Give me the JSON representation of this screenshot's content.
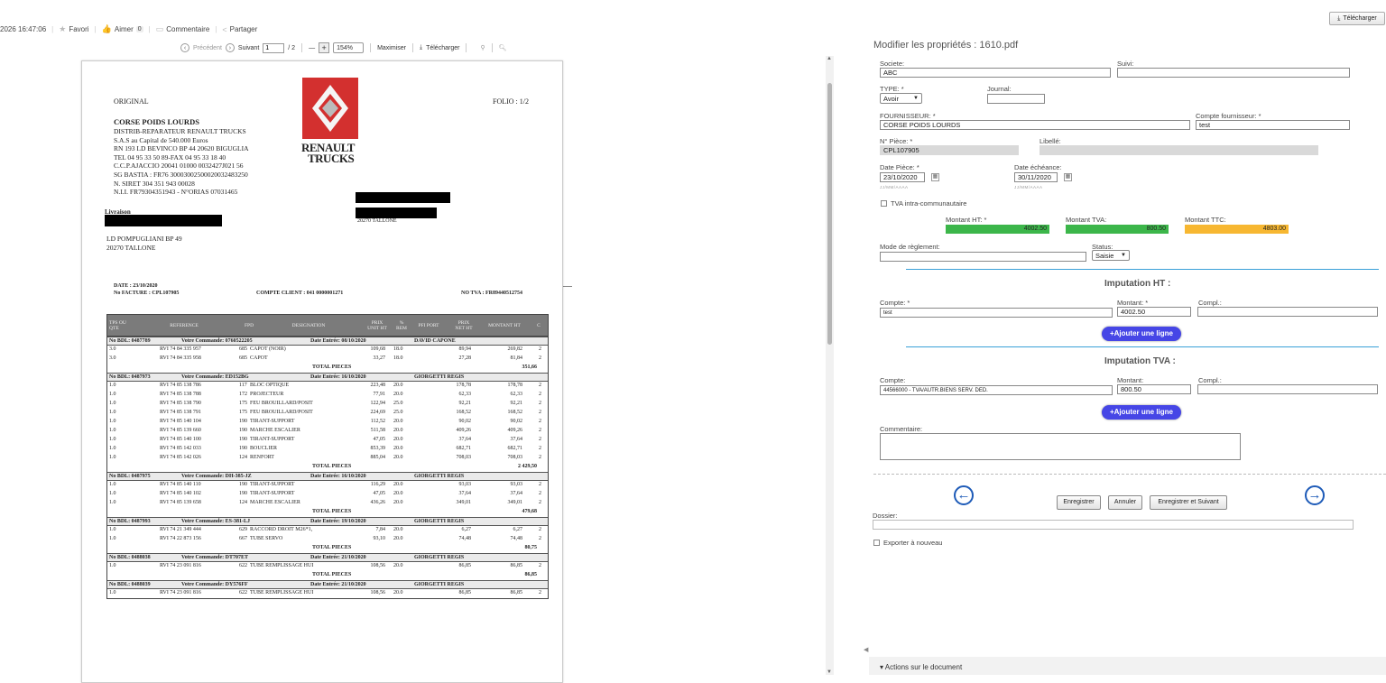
{
  "meta": {
    "datetime": "2026 16:47:06",
    "favori": "Favori",
    "aimer": "Aimer",
    "aimer_count": "0",
    "commentaire": "Commentaire",
    "partager": "Partager",
    "telecharger_top": "Télécharger"
  },
  "viewer": {
    "precedent": "Précédent",
    "suivant": "Suivant",
    "page_value": "1",
    "page_total": "/ 2",
    "minus": "—",
    "plus": "+",
    "zoom": "154%",
    "maximiser": "Maximiser",
    "telecharger": "Télécharger"
  },
  "invoice": {
    "original": "ORIGINAL",
    "folio": "FOLIO :  1/2",
    "company_name": "CORSE POIDS LOURDS",
    "company_lines": [
      "DISTRIB-REPARATEUR RENAULT TRUCKS",
      "S.A.S au Capital de 540.000 Euros",
      "RN 193 LD BEVINCO BP 44 20620 BIGUGLIA",
      "TEL 04 95 33 50 89-FAX 04 95 33 18 40",
      "C.C.P.AJACCIO 20041 01000 0032427J021 56",
      "SG BASTIA : FR76 30003002500020032483250",
      "N. SIRET 304 351 943 00028",
      "N.I.I. FR79304351943 - N°ORIAS 07031465"
    ],
    "logo_text_1": "RENAULT",
    "logo_text_2": "TRUCKS",
    "livraison": "Livraison",
    "delivery_lines": [
      "LD POMPUGLIANI BP 49",
      "20270 TALLONE"
    ],
    "client_city": "20270 TALLONE",
    "date_line": "DATE :  23/10/2020",
    "facture_line": "No  FACTURE : CPL107905",
    "compte_client": "COMPTE CLIENT : 041  0000001271",
    "no_tva": "NO TVA :  FR89440512754",
    "headers": [
      "TPS OU QTE",
      "REFERENCE",
      "FPD",
      "DESIGNATION",
      "PRIX UNIT HT",
      "% REM",
      "PFI PORT",
      "PRIX NET HT",
      "MONTANT HT",
      "C"
    ],
    "rows": [
      {
        "type": "grp",
        "bdl": "No  BDL: 0487789",
        "cmd": "Votre Commande: 0760522205",
        "date": "Date Entrée: 08/10/2020",
        "who": "DAVID CAPONE"
      },
      {
        "type": "line",
        "q": "3.0",
        "ref": "RVI 74 84 335 957",
        "fpd": "685",
        "des": "CAPOT (NOIR)",
        "pu": "109,68",
        "rem": "18.0",
        "net": "89,94",
        "mt": "269,82",
        "c": "2"
      },
      {
        "type": "line",
        "q": "3.0",
        "ref": "RVI 74 84 335 958",
        "fpd": "685",
        "des": "CAPOT",
        "pu": "33,27",
        "rem": "18.0",
        "net": "27,28",
        "mt": "81,84",
        "c": "2"
      },
      {
        "type": "tot",
        "label": "TOTAL PIECES",
        "mt": "351,66"
      },
      {
        "type": "grp",
        "bdl": "No  BDL: 0487973",
        "cmd": "Votre Commande: ED152BG",
        "date": "Date Entrée: 16/10/2020",
        "who": "GIORGETTI REGIS"
      },
      {
        "type": "line",
        "q": "1.0",
        "ref": "RVI 74 85 138 786",
        "fpd": "117",
        "des": "BLOC OPTIQUE",
        "pu": "223,48",
        "rem": "20.0",
        "net": "178,78",
        "mt": "178,78",
        "c": "2"
      },
      {
        "type": "line",
        "q": "1.0",
        "ref": "RVI 74 85 138 788",
        "fpd": "172",
        "des": "PROJECTEUR",
        "pu": "77,91",
        "rem": "20.0",
        "net": "62,33",
        "mt": "62,33",
        "c": "2"
      },
      {
        "type": "line",
        "q": "1.0",
        "ref": "RVI 74 85 138 790",
        "fpd": "175",
        "des": "FEU BROUILLARD/POSIT",
        "pu": "122,94",
        "rem": "25.0",
        "net": "92,21",
        "mt": "92,21",
        "c": "2"
      },
      {
        "type": "line",
        "q": "1.0",
        "ref": "RVI 74 85 138 791",
        "fpd": "175",
        "des": "FEU BROUILLARD/POSIT",
        "pu": "224,69",
        "rem": "25.0",
        "net": "168,52",
        "mt": "168,52",
        "c": "2"
      },
      {
        "type": "line",
        "q": "1.0",
        "ref": "RVI 74 85 140 104",
        "fpd": "190",
        "des": "TIRANT-SUPPORT",
        "pu": "112,52",
        "rem": "20.0",
        "net": "90,02",
        "mt": "90,02",
        "c": "2"
      },
      {
        "type": "line",
        "q": "1.0",
        "ref": "RVI 74 85 139 660",
        "fpd": "190",
        "des": "MARCHE ESCALIER",
        "pu": "511,58",
        "rem": "20.0",
        "net": "409,26",
        "mt": "409,26",
        "c": "2"
      },
      {
        "type": "line",
        "q": "1.0",
        "ref": "RVI 74 85 140 100",
        "fpd": "190",
        "des": "TIRANT-SUPPORT",
        "pu": "47,05",
        "rem": "20.0",
        "net": "37,64",
        "mt": "37,64",
        "c": "2"
      },
      {
        "type": "line",
        "q": "1.0",
        "ref": "RVI 74 85 142 033",
        "fpd": "190",
        "des": "BOUCLIER",
        "pu": "853,39",
        "rem": "20.0",
        "net": "682,71",
        "mt": "682,71",
        "c": "2"
      },
      {
        "type": "line",
        "q": "1.0",
        "ref": "RVI 74 85 142 026",
        "fpd": "124",
        "des": "RENFORT",
        "pu": "885,04",
        "rem": "20.0",
        "net": "708,03",
        "mt": "708,03",
        "c": "2"
      },
      {
        "type": "tot",
        "label": "TOTAL PIECES",
        "mt": "2 429,50"
      },
      {
        "type": "grp",
        "bdl": "No  BDL: 0487975",
        "cmd": "Votre Commande: DH-385-JZ",
        "date": "Date Entrée: 16/10/2020",
        "who": "GIORGETTI REGIS"
      },
      {
        "type": "line",
        "q": "1.0",
        "ref": "RVI 74 85 140 110",
        "fpd": "190",
        "des": "TIRANT-SUPPORT",
        "pu": "116,29",
        "rem": "20.0",
        "net": "93,03",
        "mt": "93,03",
        "c": "2"
      },
      {
        "type": "line",
        "q": "1.0",
        "ref": "RVI 74 85 140 102",
        "fpd": "190",
        "des": "TIRANT-SUPPORT",
        "pu": "47,05",
        "rem": "20.0",
        "net": "37,64",
        "mt": "37,64",
        "c": "2"
      },
      {
        "type": "line",
        "q": "1.0",
        "ref": "RVI 74 85 139 658",
        "fpd": "124",
        "des": "MARCHE ESCALIER",
        "pu": "436,26",
        "rem": "20.0",
        "net": "349,01",
        "mt": "349,01",
        "c": "2"
      },
      {
        "type": "tot",
        "label": "TOTAL PIECES",
        "mt": "479,68"
      },
      {
        "type": "grp",
        "bdl": "No  BDL: 0487993",
        "cmd": "Votre Commande: ES-381-LJ",
        "date": "Date Entrée: 19/10/2020",
        "who": "GIORGETTI REGIS"
      },
      {
        "type": "line",
        "q": "1.0",
        "ref": "RVI 74 21 349 444",
        "fpd": "629",
        "des": "RACCORD DROIT M26*1,",
        "pu": "7,84",
        "rem": "20.0",
        "net": "6,27",
        "mt": "6,27",
        "c": "2"
      },
      {
        "type": "line",
        "q": "1.0",
        "ref": "RVI 74 22 873 156",
        "fpd": "667",
        "des": "TUBE SERVO",
        "pu": "93,10",
        "rem": "20.0",
        "net": "74,48",
        "mt": "74,48",
        "c": "2"
      },
      {
        "type": "tot",
        "label": "TOTAL PIECES",
        "mt": "80,75"
      },
      {
        "type": "grp",
        "bdl": "No  BDL: 0488038",
        "cmd": "Votre Commande: DT707ET",
        "date": "Date Entrée: 21/10/2020",
        "who": "GIORGETTI REGIS"
      },
      {
        "type": "line",
        "q": "1.0",
        "ref": "RVI 74 23 091 816",
        "fpd": "622",
        "des": "TUBE REMPLISSAGE HUI",
        "pu": "108,56",
        "rem": "20.0",
        "net": "86,85",
        "mt": "86,85",
        "c": "2"
      },
      {
        "type": "tot",
        "label": "TOTAL PIECES",
        "mt": "86,85"
      },
      {
        "type": "grp",
        "bdl": "No  BDL: 0488039",
        "cmd": "Votre Commande: DY576FF",
        "date": "Date Entrée: 21/10/2020",
        "who": "GIORGETTI REGIS"
      },
      {
        "type": "line",
        "q": "1.0",
        "ref": "RVI 74 23 091 816",
        "fpd": "622",
        "des": "TUBE REMPLISSAGE HUI",
        "pu": "108,56",
        "rem": "20.0",
        "net": "86,85",
        "mt": "86,85",
        "c": "2"
      }
    ]
  },
  "form": {
    "title": "Modifier les propriétés : 1610.pdf",
    "societe_label": "Societe:",
    "societe_value": "ABC",
    "suivi_label": "Suivi:",
    "suivi_value": "",
    "type_label": "TYPE: *",
    "type_value": "Avoir",
    "journal_label": "Journal:",
    "journal_value": "",
    "fournisseur_label": "FOURNISSEUR: *",
    "fournisseur_value": "CORSE POIDS LOURDS",
    "compte_fournisseur_label": "Compte fournisseur: *",
    "compte_fournisseur_value": "test",
    "npiece_label": "N° Pièce: *",
    "npiece_value": "CPL107905",
    "libelle_label": "Libellé:",
    "libelle_value": "",
    "date_piece_label": "Date Pièce: *",
    "date_piece_value": "23/10/2020",
    "date_echeance_label": "Date échéance:",
    "date_echeance_value": "30/11/2020",
    "date_hint": "JJ/MM/AAAA",
    "tva_intra_label": "TVA intra-communautaire",
    "montant_ht_label": "Montant HT: *",
    "montant_ht_value": "4002.50",
    "montant_tva_label": "Montant TVA:",
    "montant_tva_value": "800.50",
    "montant_ttc_label": "Montant TTC:",
    "montant_ttc_value": "4803.00",
    "mode_reglement_label": "Mode de règlement:",
    "mode_reglement_value": "",
    "status_label": "Status:",
    "status_value": "Saisie",
    "imputation_ht_title": "Imputation HT :",
    "compte_ht_label": "Compte: *",
    "compte_ht_value": "test",
    "montant_ht2_label": "Montant: *",
    "montant_ht2_value": "4002.50",
    "compl_ht_label": "Compl.:",
    "ajouter_ligne": "+Ajouter une ligne",
    "imputation_tva_title": "Imputation TVA :",
    "compte_tva_label": "Compte:",
    "compte_tva_value": "44566000 - TVA/AUTR.BIENS SERV. DED.",
    "montant_tva2_label": "Montant:",
    "montant_tva2_value": "800.50",
    "compl_tva_label": "Compl.:",
    "commentaire_label": "Commentaire:",
    "enregistrer": "Enregistrer",
    "annuler": "Annuler",
    "enregistrer_suivant": "Enregistrer et Suivant",
    "dossier_label": "Dossier:",
    "exporter_label": "Exporter à nouveau",
    "actions_label": "▾ Actions sur le document",
    "color_green": "#3cb64a",
    "color_orange": "#f7b731"
  }
}
